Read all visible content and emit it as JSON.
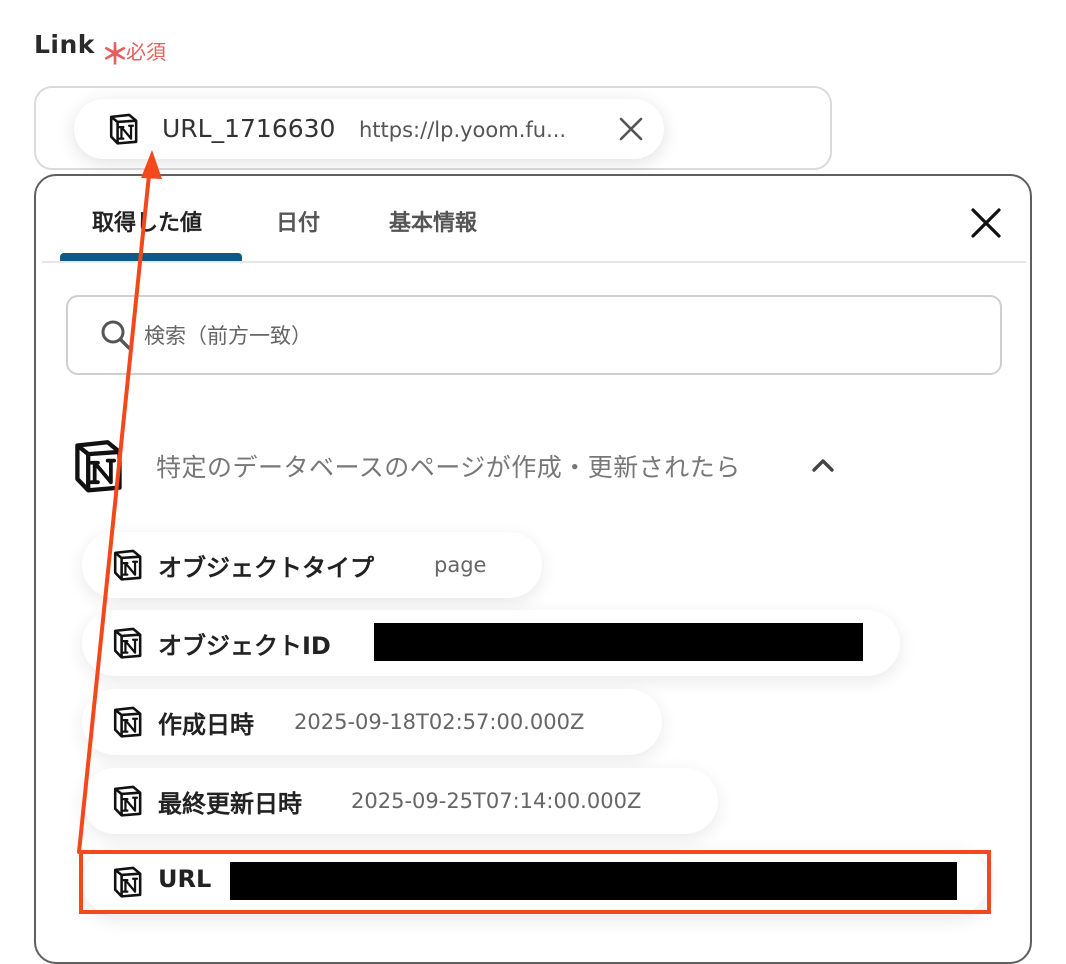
{
  "field": {
    "label": "Link",
    "required_mark": "＊",
    "required_text": "必須"
  },
  "selected_chip": {
    "name": "URL_1716630",
    "value": "https://lp.yoom.fu..."
  },
  "tabs": [
    {
      "label": "取得した値",
      "active": true
    },
    {
      "label": "日付",
      "active": false
    },
    {
      "label": "基本情報",
      "active": false
    }
  ],
  "search": {
    "placeholder": "検索（前方一致）",
    "value": ""
  },
  "group": {
    "title": "特定のデータベースのページが作成・更新されたら",
    "expanded": true
  },
  "items": [
    {
      "name": "オブジェクトタイプ",
      "value": "page",
      "redacted": false
    },
    {
      "name": "オブジェクトID",
      "value": "",
      "redacted": true
    },
    {
      "name": "作成日時",
      "value": "2025-09-18T02:57:00.000Z",
      "redacted": false
    },
    {
      "name": "最終更新日時",
      "value": "2025-09-25T07:14:00.000Z",
      "redacted": false
    },
    {
      "name": "URL",
      "value": "",
      "redacted": true,
      "highlighted": true
    }
  ],
  "colors": {
    "accent": "#0d5b82",
    "required": "#e85d5d",
    "annotation": "#f2481c",
    "redaction": "#000000"
  },
  "icons": {
    "chip": "notion-icon",
    "remove": "close-icon",
    "panel_close": "close-icon",
    "search": "search-icon",
    "group": "notion-icon",
    "collapse": "chevron-up-icon"
  }
}
